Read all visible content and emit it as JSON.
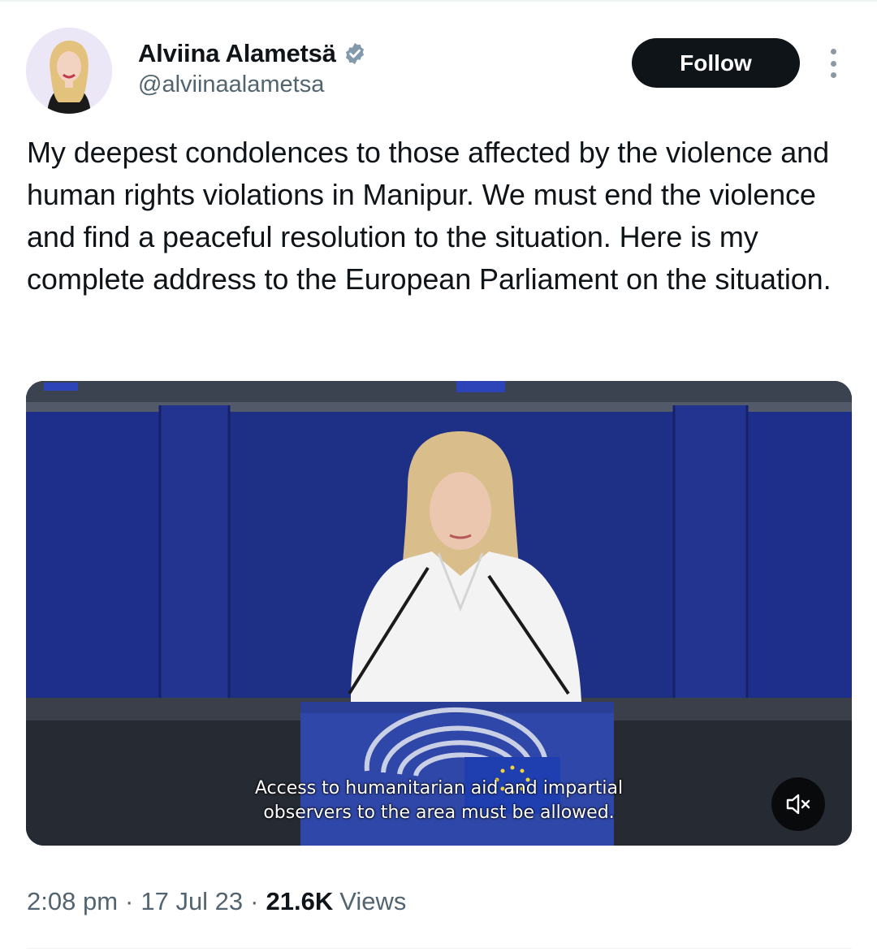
{
  "author": {
    "display_name": "Alviina Alametsä",
    "handle": "@alviinaalametsa",
    "verified": true,
    "avatar_icon": "profile-photo"
  },
  "actions": {
    "follow_label": "Follow",
    "more_icon": "more-vertical-icon"
  },
  "tweet": {
    "text": "My deepest condolences to those affected by the violence and human rights violations in Manipur. We must end the violence and find a peaceful resolution to the situation. Here is my complete address to the European Parliament on the situation."
  },
  "media": {
    "type": "video",
    "subtitle_line1": "Access to humanitarian aid and impartial",
    "subtitle_line2": "observers to the area must be allowed.",
    "muted": true,
    "mute_icon": "speaker-muted-icon"
  },
  "meta": {
    "time": "2:08 pm",
    "date": "17 Jul 23",
    "views_count": "21.6K",
    "views_label": "Views",
    "separator": "·"
  },
  "colors": {
    "text": "#0f1419",
    "secondary": "#536471",
    "verified": "#829aab",
    "button_bg": "#0f1419",
    "parliament_blue": "#1d2f8a"
  }
}
